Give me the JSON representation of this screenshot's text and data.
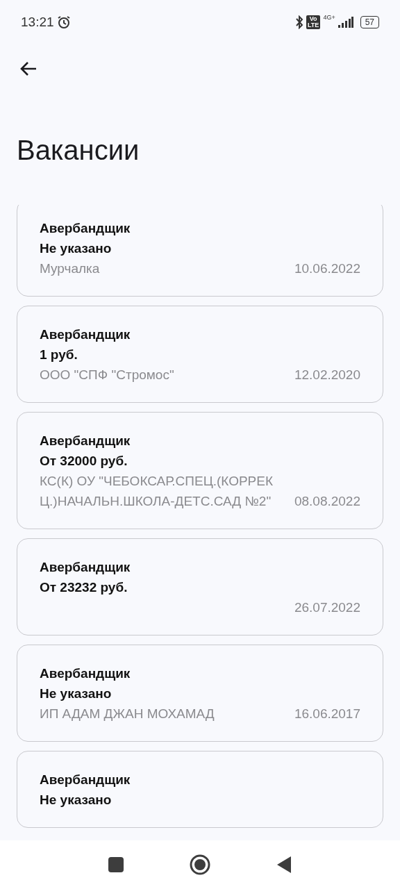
{
  "status_bar": {
    "time": "13:21",
    "volte": [
      "Vo",
      "LTE"
    ],
    "network": "4G+",
    "battery": "57"
  },
  "title": "Вакансии",
  "vacancies": [
    {
      "position": "Авербандщик",
      "salary": "Не указано",
      "company": "Мурчалка",
      "date": "10.06.2022"
    },
    {
      "position": "Авербандщик",
      "salary": "1 руб.",
      "company": "ООО \"СПФ \"Стромос\"",
      "date": "12.02.2020"
    },
    {
      "position": "Авербандщик",
      "salary": "От 32000 руб.",
      "company": "КС(К) ОУ \"ЧЕБОКСАР.СПЕЦ.(КОРРЕКЦ.)НАЧАЛЬН.ШКОЛА-ДЕТС.САД №2\"",
      "date": "08.08.2022"
    },
    {
      "position": "Авербандщик",
      "salary": "От 23232 руб.",
      "date": "26.07.2022"
    },
    {
      "position": "Авербандщик",
      "salary": "Не указано",
      "company": "ИП АДАМ ДЖАН МОХАМАД",
      "date": "16.06.2017"
    },
    {
      "position": "Авербандщик",
      "salary": "Не указано"
    }
  ]
}
